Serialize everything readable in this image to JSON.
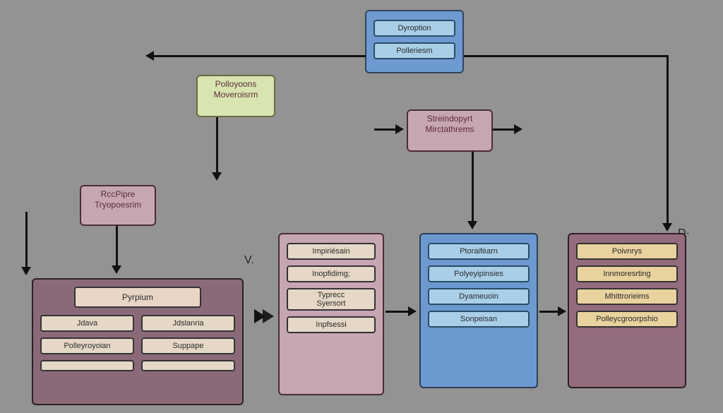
{
  "top_box": {
    "a": "Dyroption",
    "b": "Polleriesm"
  },
  "green_box": {
    "a": "Polloyoons",
    "b": "Moveroisrm"
  },
  "streind_box": {
    "a": "Streindopyrt",
    "b": "Mirctathrems"
  },
  "rcp_box": {
    "a": "RccPipre",
    "b": "Tryopoesrim"
  },
  "v_label": "V.",
  "d_label": "D·",
  "darkm": {
    "title": "Pyrpium",
    "r1a": "Jdava",
    "r1b": "Jdslanria",
    "r2a": "Polleyroyoian",
    "r2b": "Suppape",
    "r3a": "",
    "r3b": ""
  },
  "mauve_list": {
    "a": "Impiriésain",
    "b": "Inopfidimg;",
    "c1": "Typrecc",
    "c2": "Syersort",
    "d": "Inpfsessi"
  },
  "blue_list": {
    "a": "Ptoraifèarn",
    "b": "Polyeyipinsies",
    "c": "Dyameuoin",
    "d": "Sonpeisan"
  },
  "plum_list": {
    "a": "Poivnrys",
    "b": "Innmoresrting",
    "c": "Mhittrorieims",
    "d": "Polleycgroorpshio"
  }
}
